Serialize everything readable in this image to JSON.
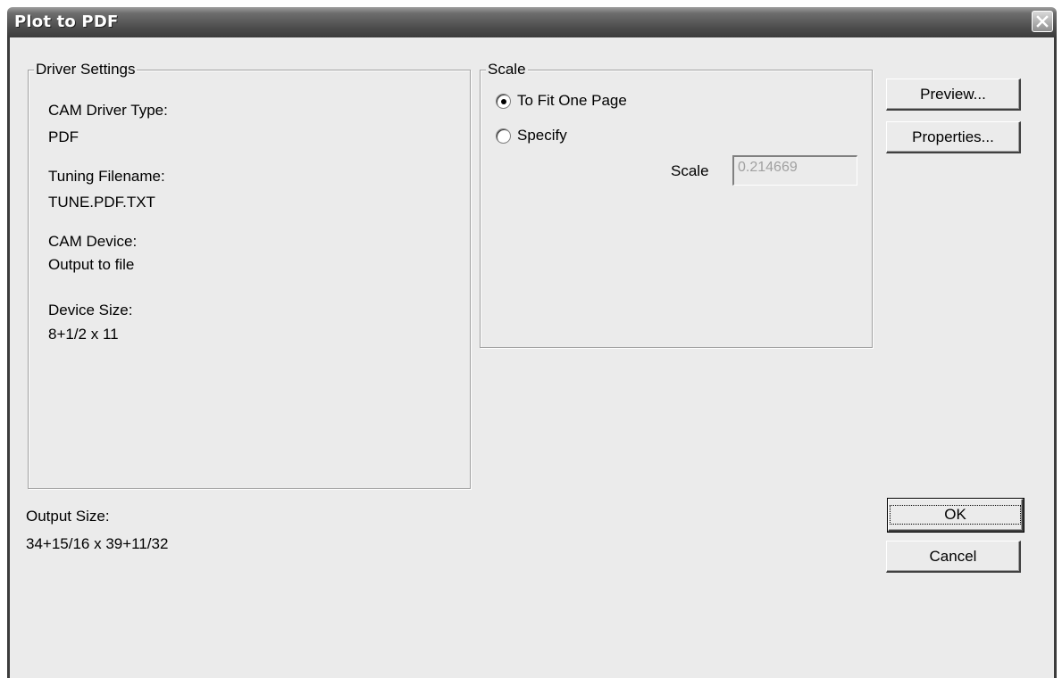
{
  "window": {
    "title": "Plot to PDF"
  },
  "driver_settings": {
    "title": "Driver Settings",
    "cam_driver_type_label": "CAM Driver Type:",
    "cam_driver_type_value": "PDF",
    "tuning_filename_label": "Tuning Filename:",
    "tuning_filename_value": "TUNE.PDF.TXT",
    "cam_device_label": "CAM Device:",
    "cam_device_value": "Output to file",
    "device_size_label": "Device Size:",
    "device_size_value": "8+1/2 x 11"
  },
  "scale": {
    "title": "Scale",
    "option_fit": "To Fit One Page",
    "option_specify": "Specify",
    "selected": "fit",
    "scale_label": "Scale",
    "scale_value": "0.214669"
  },
  "output": {
    "label": "Output Size:",
    "value": "34+15/16 x 39+11/32"
  },
  "buttons": {
    "preview": "Preview...",
    "properties": "Properties...",
    "ok": "OK",
    "cancel": "Cancel"
  },
  "icons": {
    "close": "close-icon"
  }
}
